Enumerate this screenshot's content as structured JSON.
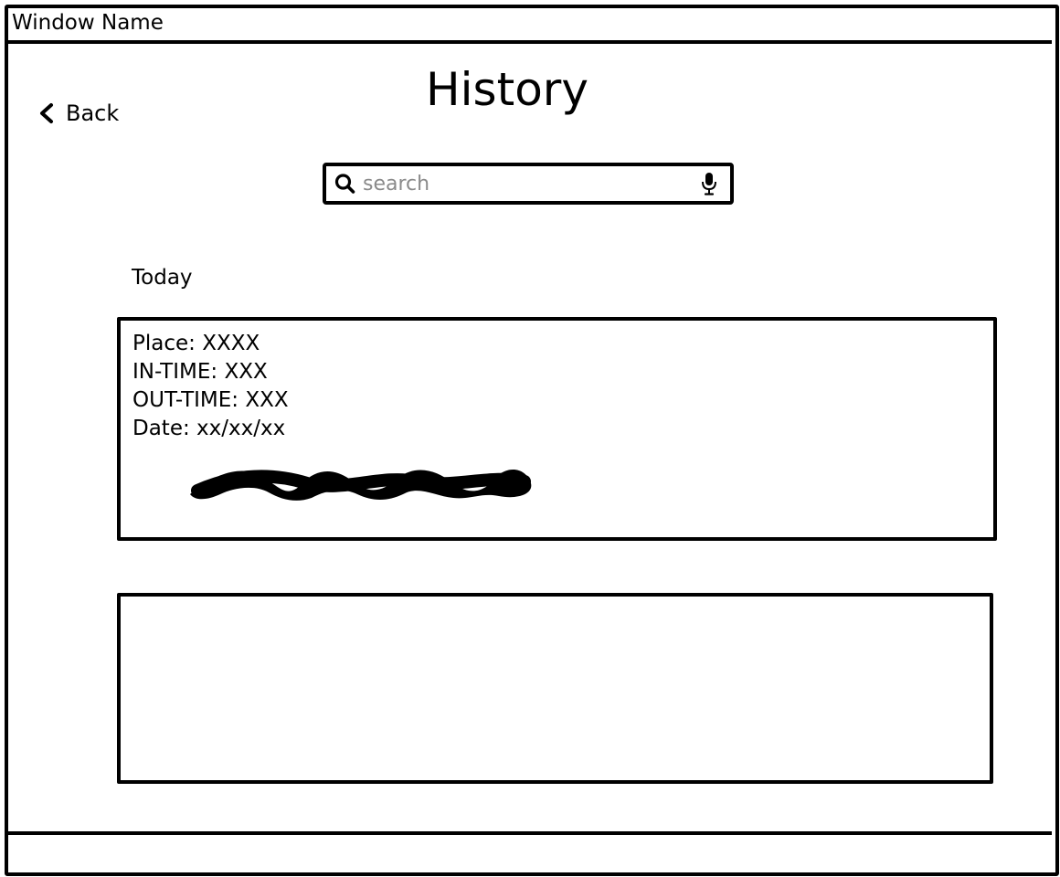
{
  "window": {
    "title": "Window Name"
  },
  "header": {
    "back_label": "Back",
    "title": "History"
  },
  "search": {
    "placeholder": "search",
    "value": ""
  },
  "history": {
    "section_label": "Today",
    "cards": [
      {
        "place": "Place: XXXX",
        "in_time": "IN-TIME: XXX",
        "out_time": "OUT-TIME: XXX",
        "date": "Date: xx/xx/xx"
      }
    ]
  },
  "icons": {
    "back": "chevron-left-icon",
    "search": "search-icon",
    "mic": "microphone-icon"
  },
  "colors": {
    "ink": "#000000",
    "background": "#ffffff",
    "placeholder": "#8a8a8a"
  }
}
